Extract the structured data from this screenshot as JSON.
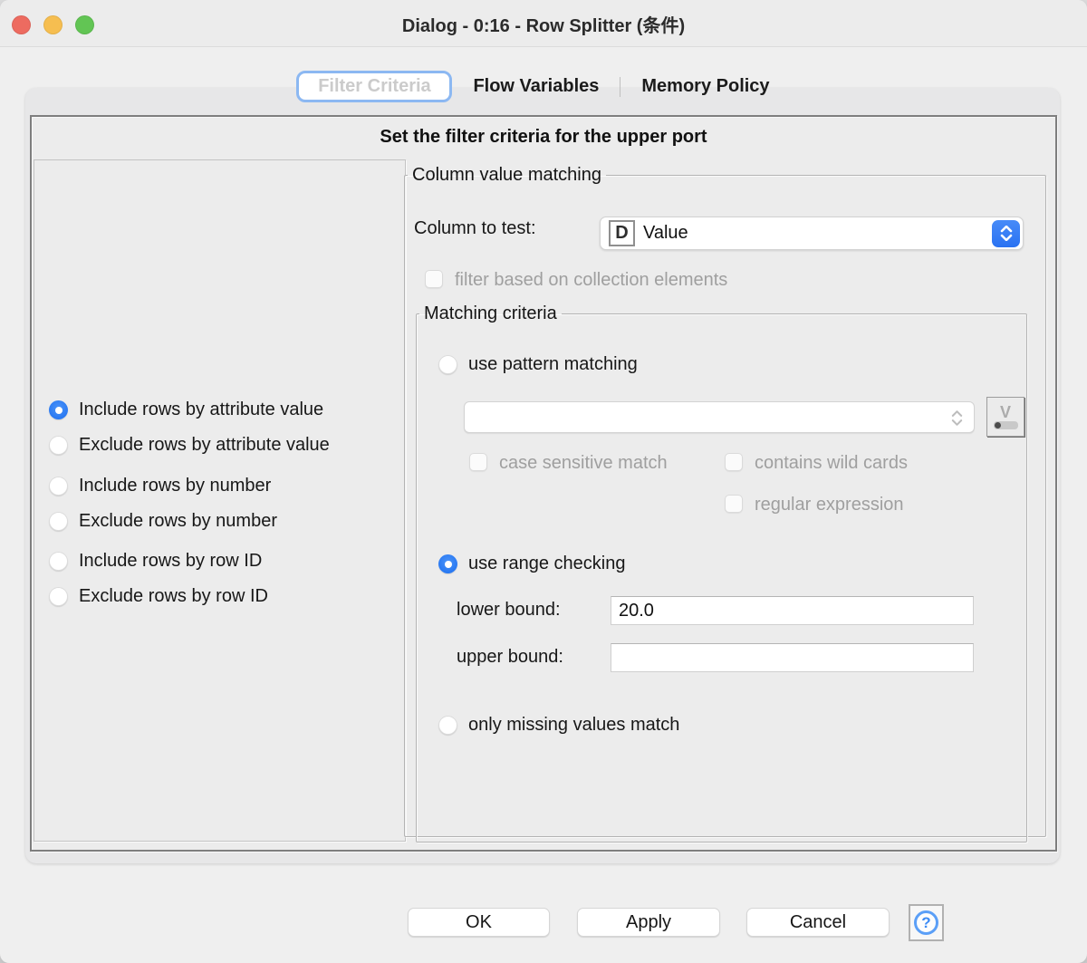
{
  "window": {
    "title": "Dialog - 0:16 - Row Splitter (条件)"
  },
  "tabs": [
    {
      "label": "Filter Criteria",
      "selected": true
    },
    {
      "label": "Flow Variables",
      "selected": false
    },
    {
      "label": "Memory Policy",
      "selected": false
    }
  ],
  "header": {
    "title": "Set the filter criteria for the upper port"
  },
  "left_panel": {
    "options": [
      {
        "label": "Include rows by attribute value",
        "selected": true
      },
      {
        "label": "Exclude rows by attribute value",
        "selected": false
      },
      {
        "label": "Include rows by number",
        "selected": false
      },
      {
        "label": "Exclude rows by number",
        "selected": false
      },
      {
        "label": "Include rows by row ID",
        "selected": false
      },
      {
        "label": "Exclude rows by row ID",
        "selected": false
      }
    ]
  },
  "column_matching": {
    "legend": "Column value matching",
    "column_to_test_label": "Column to test:",
    "type_badge": "D",
    "selected_column": "Value",
    "collection_checkbox_label": "filter based on collection elements",
    "collection_checkbox_checked": false
  },
  "matching_criteria": {
    "legend": "Matching criteria",
    "pattern_radio_label": "use pattern matching",
    "pattern_radio_selected": false,
    "pattern_value": "",
    "case_sensitive_label": "case sensitive match",
    "wild_cards_label": "contains wild cards",
    "regex_label": "regular expression",
    "flow_variable_button_glyph": "V",
    "range_radio_label": "use range checking",
    "range_radio_selected": true,
    "lower_bound_label": "lower bound:",
    "lower_bound_value": "20.0",
    "upper_bound_label": "upper bound:",
    "upper_bound_value": "",
    "missing_radio_label": "only missing values match",
    "missing_radio_selected": false
  },
  "footer": {
    "ok_label": "OK",
    "apply_label": "Apply",
    "cancel_label": "Cancel",
    "help_glyph": "?"
  },
  "colors": {
    "accent_blue": "#2e7ef7",
    "selected_radio_blue": "#1b6ef0",
    "tab_ring_blue": "#8cb8f2",
    "traffic_red": "#ed6b60",
    "traffic_yellow": "#f6be50",
    "traffic_green": "#62c554",
    "disabled_text": "#9f9f9f",
    "panel_bg": "#ececec"
  }
}
